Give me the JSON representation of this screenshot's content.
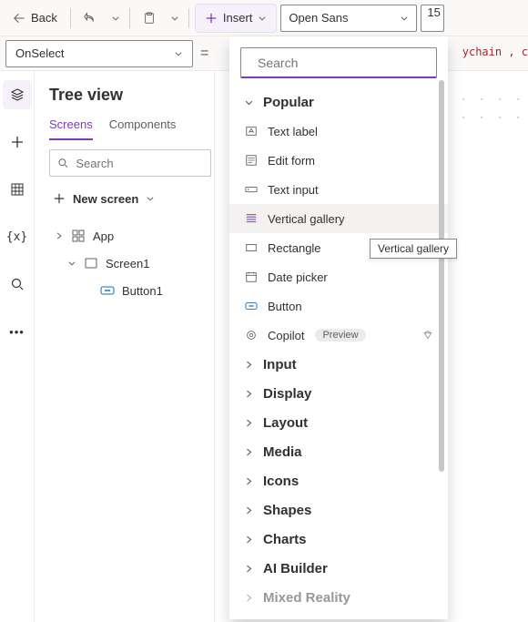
{
  "topbar": {
    "back": "Back",
    "insert": "Insert",
    "font": "Open Sans",
    "fontsize": "15"
  },
  "formula": {
    "property": "OnSelect",
    "fragment": "ychain ,  c"
  },
  "tree": {
    "title": "Tree view",
    "tabs": {
      "screens": "Screens",
      "components": "Components"
    },
    "search_placeholder": "Search",
    "new_screen": "New screen",
    "items": {
      "app": "App",
      "screen1": "Screen1",
      "button1": "Button1"
    }
  },
  "insert_panel": {
    "search_placeholder": "Search",
    "popular": {
      "header": "Popular",
      "text_label": "Text label",
      "edit_form": "Edit form",
      "text_input": "Text input",
      "vertical_gallery": "Vertical gallery",
      "rectangle": "Rectangle",
      "date_picker": "Date picker",
      "button": "Button",
      "copilot": "Copilot",
      "preview_badge": "Preview"
    },
    "categories": {
      "input": "Input",
      "display": "Display",
      "layout": "Layout",
      "media": "Media",
      "icons": "Icons",
      "shapes": "Shapes",
      "charts": "Charts",
      "ai_builder": "AI Builder",
      "mixed_reality": "Mixed Reality"
    },
    "tooltip": "Vertical gallery"
  }
}
